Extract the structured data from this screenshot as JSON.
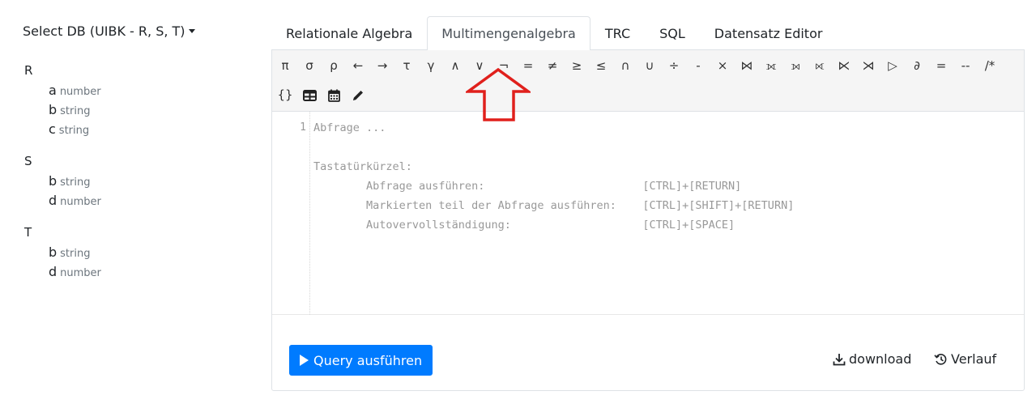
{
  "sidebar": {
    "db_select_label": "Select DB (UIBK - R, S, T)",
    "relations": [
      {
        "name": "R",
        "attributes": [
          {
            "name": "a",
            "type": "number"
          },
          {
            "name": "b",
            "type": "string"
          },
          {
            "name": "c",
            "type": "string"
          }
        ]
      },
      {
        "name": "S",
        "attributes": [
          {
            "name": "b",
            "type": "string"
          },
          {
            "name": "d",
            "type": "number"
          }
        ]
      },
      {
        "name": "T",
        "attributes": [
          {
            "name": "b",
            "type": "string"
          },
          {
            "name": "d",
            "type": "number"
          }
        ]
      }
    ]
  },
  "tabs": [
    {
      "label": "Relationale Algebra",
      "active": false
    },
    {
      "label": "Multimengenalgebra",
      "active": true
    },
    {
      "label": "TRC",
      "active": false
    },
    {
      "label": "SQL",
      "active": false
    },
    {
      "label": "Datensatz Editor",
      "active": false
    }
  ],
  "toolbar": {
    "operators": [
      "π",
      "σ",
      "ρ",
      "←",
      "→",
      "τ",
      "γ",
      "∧",
      "∨",
      "¬",
      "=",
      "≠",
      "≥",
      "≤",
      "∩",
      "∪",
      "÷",
      "-",
      "×",
      "⋈",
      "⟗",
      "⟕",
      "⟖",
      "⋉",
      "⋊",
      "▷",
      "∂",
      "=",
      "--",
      "/*"
    ],
    "extras": [
      {
        "label": "{}",
        "icon": ""
      },
      {
        "label": "",
        "icon": "table-icon"
      },
      {
        "label": "",
        "icon": "calendar-icon"
      },
      {
        "label": "",
        "icon": "pencil-icon"
      }
    ]
  },
  "editor": {
    "line_number": "1",
    "placeholder_lines": [
      "Abfrage ...",
      "",
      "Tastatürkürzel:",
      "        Abfrage ausführen:                        [CTRL]+[RETURN]",
      "        Markierten teil der Abfrage ausführen:    [CTRL]+[SHIFT]+[RETURN]",
      "        Autovervollständigung:                    [CTRL]+[SPACE]"
    ]
  },
  "actions": {
    "run_label": "Query ausführen",
    "download_label": "download",
    "history_label": "Verlauf"
  },
  "colors": {
    "primary": "#007bff",
    "arrow": "#e0201c",
    "toolbar_bg": "#f5f5f5"
  }
}
